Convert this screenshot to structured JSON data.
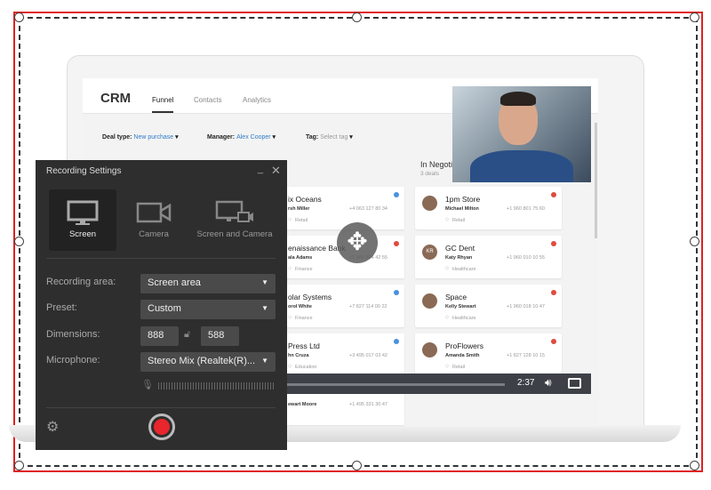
{
  "crm": {
    "title": "CRM",
    "tabs": [
      {
        "label": "Funnel",
        "active": true
      },
      {
        "label": "Contacts"
      },
      {
        "label": "Analytics"
      }
    ],
    "filters": {
      "deal_type_label": "Deal type:",
      "deal_type_value": "New purchase",
      "manager_label": "Manager:",
      "manager_value": "Alex Cooper",
      "tag_label": "Tag:",
      "tag_placeholder": "Select tag"
    },
    "column_right": {
      "title": "In Negoti",
      "count": "3 deals"
    },
    "left_cards": [
      {
        "name": "ix Oceans",
        "person": "rsh Miller",
        "phone": "+4 063 127 80 34",
        "tag": "Retail",
        "dot": "#4a90e2"
      },
      {
        "name": "enaissance Bank",
        "person": "ala Adams",
        "phone": "+1 960 804 42 55",
        "tag": "Finance",
        "dot": "#e04b3c"
      },
      {
        "name": "olar Systems",
        "person": "orol White",
        "phone": "+7 827 114 00 22",
        "tag": "Finance",
        "dot": "#4a90e2"
      },
      {
        "name": "Press Ltd",
        "person": "hn Cruza",
        "phone": "+3 495 017 03 42",
        "tag": "Education",
        "dot": "#4a90e2"
      },
      {
        "name": "",
        "person": "ewart Moore",
        "phone": "+1 495 331 30 47",
        "tag": "",
        "dot": ""
      }
    ],
    "right_cards": [
      {
        "name": "1pm Store",
        "person": "Michael Milton",
        "phone": "+1 960 801 75 60",
        "tag": "Retail",
        "dot": "#e04b3c",
        "avatar": ""
      },
      {
        "name": "GC Dent",
        "person": "Katy Rhyan",
        "phone": "+1 960 010 10 55",
        "tag": "Healthcare",
        "dot": "#e04b3c",
        "avatar": "KR"
      },
      {
        "name": "Space",
        "person": "Kelly Stewart",
        "phone": "+1 960 018 10 47",
        "tag": "Healthcare",
        "dot": "#e04b3c",
        "avatar": ""
      },
      {
        "name": "ProFlowers",
        "person": "Amanda Smith",
        "phone": "+1 827 128 10 15",
        "tag": "Retail",
        "dot": "#e04b3c",
        "avatar": ""
      }
    ]
  },
  "video": {
    "time": "2:37",
    "icons": [
      "volume-icon",
      "fullscreen-icon"
    ]
  },
  "panel": {
    "title": "Recording Settings",
    "modes": [
      {
        "label": "Screen",
        "selected": true,
        "icon": "monitor-icon"
      },
      {
        "label": "Camera",
        "icon": "camera-icon"
      },
      {
        "label": "Screen and Camera",
        "icon": "monitor-camera-icon"
      }
    ],
    "recording_area_label": "Recording area:",
    "recording_area_value": "Screen area",
    "preset_label": "Preset:",
    "preset_value": "Custom",
    "dimensions_label": "Dimensions:",
    "width": "888",
    "height": "588",
    "microphone_label": "Microphone:",
    "microphone_value": "Stereo Mix (Realtek(R)...",
    "record_color": "#e8262c"
  },
  "colors": {
    "frame": "#e02020",
    "accent": "#2f7dc7"
  }
}
